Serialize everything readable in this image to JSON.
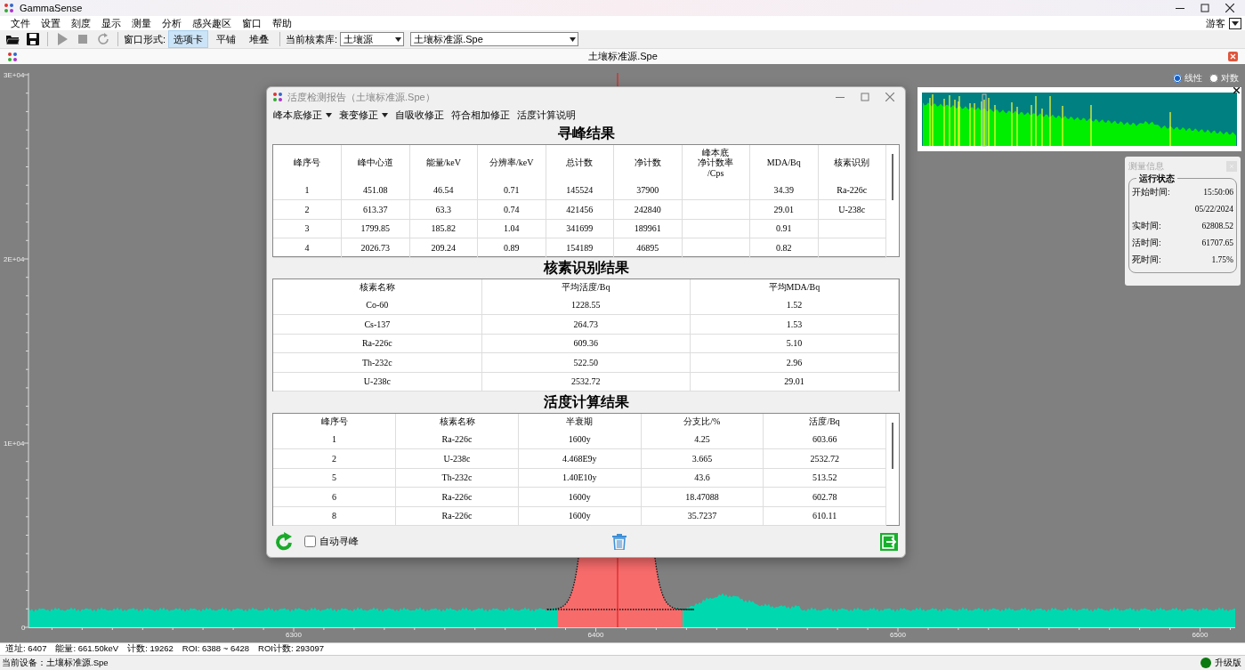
{
  "window": {
    "title": "GammaSense"
  },
  "menu": [
    "文件",
    "设置",
    "刻度",
    "显示",
    "测量",
    "分析",
    "感兴趣区",
    "窗口",
    "帮助"
  ],
  "user": "游客",
  "toolbar": {
    "tools": [
      {
        "kind": "open",
        "disabled": false
      },
      {
        "kind": "save",
        "disabled": false
      },
      {
        "kind": "play",
        "disabled": true
      },
      {
        "kind": "stop",
        "disabled": true
      },
      {
        "kind": "refresh",
        "disabled": true
      }
    ],
    "mode_label": "窗口形式:",
    "modes": [
      {
        "label": "选项卡",
        "selected": true
      },
      {
        "label": "平铺",
        "selected": false
      },
      {
        "label": "堆叠",
        "selected": false
      }
    ],
    "library_label": "当前核素库:",
    "library": "土壤源",
    "file": "土壤标准源.Spe"
  },
  "document": {
    "title": "土壤标准源.Spe"
  },
  "scale": [
    {
      "label": "线性",
      "selected": true
    },
    {
      "label": "对数",
      "selected": false
    }
  ],
  "plot": {
    "y_ticks": [
      "3E+04",
      "2E+04",
      "1E+04",
      "0"
    ],
    "x_ticks": [
      "6300",
      "6400",
      "6500",
      "6600"
    ]
  },
  "dialog": {
    "title": "活度检测报告（土壤标准源.Spe）",
    "menu": [
      {
        "label": "峰本底修正",
        "kind": "dropdown"
      },
      {
        "label": "衰变修正",
        "kind": "dropdown"
      },
      {
        "label": "自吸收修正",
        "kind": "plain"
      },
      {
        "label": "符合相加修正",
        "kind": "plain"
      },
      {
        "label": "活度计算说明",
        "kind": "plain"
      }
    ],
    "sections": [
      {
        "title": "寻峰结果",
        "scrollbar": true,
        "columns": [
          "峰序号",
          "峰中心道",
          "能量/keV",
          "分辨率/keV",
          "总计数",
          "净计数",
          [
            "峰本底",
            "净计数率",
            "/Cps"
          ],
          "MDA/Bq",
          "核素识别"
        ],
        "rows": [
          [
            "1",
            "451.08",
            "46.54",
            "0.71",
            "145524",
            "37900",
            null,
            "34.39",
            "Ra-226c"
          ],
          [
            "2",
            "613.37",
            "63.3",
            "0.74",
            "421456",
            "242840",
            null,
            "29.01",
            "U-238c"
          ],
          [
            "3",
            "1799.85",
            "185.82",
            "1.04",
            "341699",
            "189961",
            null,
            "0.91",
            null
          ],
          [
            "4",
            "2026.73",
            "209.24",
            "0.89",
            "154189",
            "46895",
            null,
            "0.82",
            null
          ]
        ]
      },
      {
        "title": "核素识别结果",
        "scrollbar": false,
        "columns": [
          "核素名称",
          "平均活度/Bq",
          "平均MDA/Bq"
        ],
        "rows": [
          [
            "Co-60",
            "1228.55",
            "1.52"
          ],
          [
            "Cs-137",
            "264.73",
            "1.53"
          ],
          [
            "Ra-226c",
            "609.36",
            "5.10"
          ],
          [
            "Th-232c",
            "522.50",
            "2.96"
          ],
          [
            "U-238c",
            "2532.72",
            "29.01"
          ]
        ]
      },
      {
        "title": "活度计算结果",
        "scrollbar": true,
        "columns": [
          "峰序号",
          "核素名称",
          "半衰期",
          "分支比/%",
          "活度/Bq"
        ],
        "rows": [
          [
            "1",
            "Ra-226c",
            "1600y",
            "4.25",
            "603.66"
          ],
          [
            "2",
            "U-238c",
            "4.468E9y",
            "3.665",
            "2532.72"
          ],
          [
            "5",
            "Th-232c",
            "1.40E10y",
            "43.6",
            "513.52"
          ],
          [
            "6",
            "Ra-226c",
            "1600y",
            "18.47088",
            "602.78"
          ],
          [
            "8",
            "Ra-226c",
            "1600y",
            "35.7237",
            "610.11"
          ]
        ]
      }
    ],
    "auto_peak": {
      "label": "自动寻峰",
      "checked": false
    }
  },
  "info_panel": {
    "title": "测量信息",
    "group": "运行状态",
    "rows": [
      {
        "label": "开始时间:",
        "value": "15:50:06"
      },
      {
        "value": "05/22/2024"
      },
      {
        "label": "实时间:",
        "value": "62808.52"
      },
      {
        "label": "活时间:",
        "value": "61707.65"
      },
      {
        "label": "死时间:",
        "value": "1.75%"
      }
    ]
  },
  "readout": [
    "道址: 6407",
    "能量: 661.50keV",
    "计数: 19262",
    "ROI: 6388 ~ 6428",
    "ROI计数: 293097"
  ],
  "status_bar": {
    "device": "当前设备：土壤标准源.Spe",
    "edition": "升级版"
  }
}
